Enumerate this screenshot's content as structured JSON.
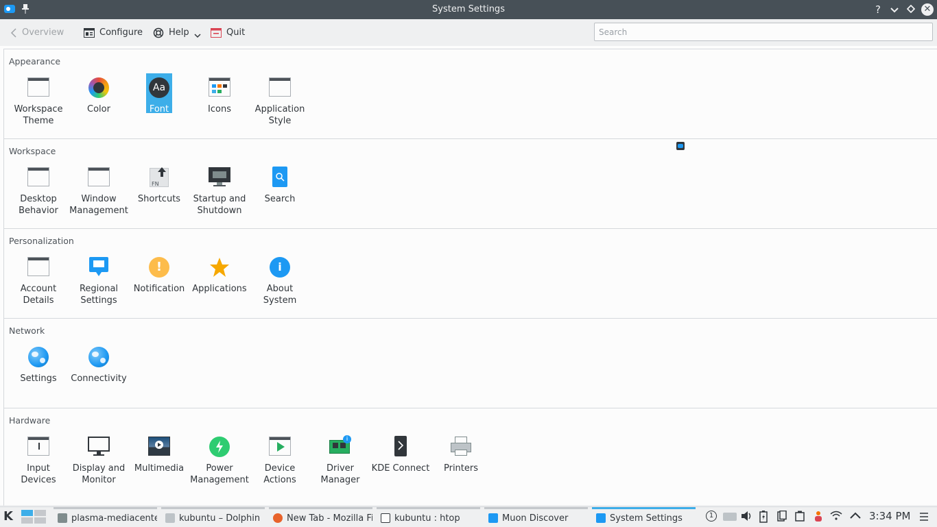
{
  "window": {
    "title": "System Settings"
  },
  "toolbar": {
    "overview": "Overview",
    "configure": "Configure",
    "help": "Help",
    "quit": "Quit",
    "search_placeholder": "Search"
  },
  "sections": [
    {
      "title": "Appearance",
      "items": [
        {
          "label": "Workspace Theme",
          "icon": "workspace-theme-icon"
        },
        {
          "label": "Color",
          "icon": "color-icon"
        },
        {
          "label": "Font",
          "icon": "font-icon",
          "selected": true
        },
        {
          "label": "Icons",
          "icon": "icons-icon"
        },
        {
          "label": "Application Style",
          "icon": "application-style-icon"
        }
      ]
    },
    {
      "title": "Workspace",
      "items": [
        {
          "label": "Desktop Behavior",
          "icon": "desktop-behavior-icon"
        },
        {
          "label": "Window Management",
          "icon": "window-management-icon"
        },
        {
          "label": "Shortcuts",
          "icon": "shortcuts-icon"
        },
        {
          "label": "Startup and Shutdown",
          "icon": "startup-shutdown-icon"
        },
        {
          "label": "Search",
          "icon": "search-icon"
        }
      ]
    },
    {
      "title": "Personalization",
      "items": [
        {
          "label": "Account Details",
          "icon": "account-details-icon"
        },
        {
          "label": "Regional Settings",
          "icon": "regional-settings-icon"
        },
        {
          "label": "Notification",
          "icon": "notification-icon"
        },
        {
          "label": "Applications",
          "icon": "applications-icon"
        },
        {
          "label": "About System",
          "icon": "about-system-icon"
        }
      ]
    },
    {
      "title": "Network",
      "items": [
        {
          "label": "Settings",
          "icon": "network-settings-icon"
        },
        {
          "label": "Connectivity",
          "icon": "connectivity-icon"
        }
      ]
    },
    {
      "title": "Hardware",
      "items": [
        {
          "label": "Input Devices",
          "icon": "input-devices-icon"
        },
        {
          "label": "Display and Monitor",
          "icon": "display-monitor-icon"
        },
        {
          "label": "Multimedia",
          "icon": "multimedia-icon"
        },
        {
          "label": "Power Management",
          "icon": "power-management-icon"
        },
        {
          "label": "Device Actions",
          "icon": "device-actions-icon"
        },
        {
          "label": "Driver Manager",
          "icon": "driver-manager-icon"
        },
        {
          "label": "KDE Connect",
          "icon": "kde-connect-icon"
        },
        {
          "label": "Printers",
          "icon": "printers-icon"
        }
      ]
    }
  ],
  "taskbar": {
    "tasks": [
      {
        "label": "plasma-mediacenter",
        "icon": "plasma-mediacenter-icon"
      },
      {
        "label": "kubuntu – Dolphin",
        "icon": "folder-icon"
      },
      {
        "label": "New Tab - Mozilla Fi",
        "icon": "firefox-icon"
      },
      {
        "label": "kubuntu : htop",
        "icon": "terminal-icon"
      },
      {
        "label": "Muon Discover",
        "icon": "muon-discover-icon"
      },
      {
        "label": "System Settings",
        "icon": "system-settings-icon",
        "active": true
      }
    ],
    "tray": {
      "notifications_count": "1"
    },
    "clock": "3:34 PM"
  },
  "colors": {
    "accent": "#3daee9",
    "titlebar": "#475057",
    "panel": "#eff0f1",
    "content": "#fcfcfc"
  }
}
